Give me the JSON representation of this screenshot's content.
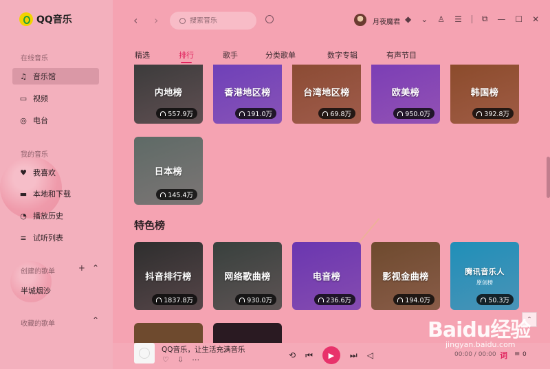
{
  "app": {
    "logo_text": "QQ音乐"
  },
  "sidebar": {
    "online_title": "在线音乐",
    "online_items": [
      {
        "label": "音乐馆",
        "icon": "music-note-icon",
        "active": true
      },
      {
        "label": "视频",
        "icon": "video-icon",
        "active": false
      },
      {
        "label": "电台",
        "icon": "radio-icon",
        "active": false
      }
    ],
    "my_title": "我的音乐",
    "my_items": [
      {
        "label": "我喜欢",
        "icon": "heart-icon"
      },
      {
        "label": "本地和下载",
        "icon": "monitor-icon"
      },
      {
        "label": "播放历史",
        "icon": "history-icon"
      },
      {
        "label": "试听列表",
        "icon": "list-icon"
      }
    ],
    "created_title": "创建的歌单",
    "created_playlists": [
      "半城烟沙"
    ],
    "collected_title": "收藏的歌单"
  },
  "topbar": {
    "search_placeholder": "搜索音乐",
    "username": "月夜魔君"
  },
  "tabs": [
    {
      "label": "精选",
      "active": false
    },
    {
      "label": "排行",
      "active": true
    },
    {
      "label": "歌手",
      "active": false
    },
    {
      "label": "分类歌单",
      "active": false
    },
    {
      "label": "数字专辑",
      "active": false
    },
    {
      "label": "有声节目",
      "active": false
    }
  ],
  "region_charts": [
    {
      "title": "内地榜",
      "plays": "557.9万",
      "color": "#3a3a3a"
    },
    {
      "title": "香港地区榜",
      "plays": "191.0万",
      "color": "#6d3fb8"
    },
    {
      "title": "台湾地区榜",
      "plays": "69.8万",
      "color": "#8a4a32"
    },
    {
      "title": "欧美榜",
      "plays": "950.0万",
      "color": "#7a3db5"
    },
    {
      "title": "韩国榜",
      "plays": "392.8万",
      "color": "#8a4a2a"
    },
    {
      "title": "日本榜",
      "plays": "145.4万",
      "color": "#5e6a66"
    }
  ],
  "featured_title": "特色榜",
  "featured_charts": [
    {
      "title": "抖音排行榜",
      "plays": "1837.8万",
      "color": "#2e2e2e"
    },
    {
      "title": "网络歌曲榜",
      "plays": "930.0万",
      "color": "#38403d"
    },
    {
      "title": "电音榜",
      "plays": "236.6万",
      "color": "#6a36b0"
    },
    {
      "title": "影视金曲榜",
      "plays": "194.0万",
      "color": "#6e4a2e"
    },
    {
      "title": "腾讯音乐人",
      "subtitle": "原创榜",
      "plays": "50.3万",
      "color": "#1f8fb8"
    }
  ],
  "player": {
    "song": "QQ音乐，让生活充满音乐",
    "time": "00:00 / 00:00",
    "lyric_label": "词",
    "queue_count": "0"
  },
  "watermark": {
    "logo": "Baidu经验",
    "sub": "jingyan.baidu.com"
  }
}
